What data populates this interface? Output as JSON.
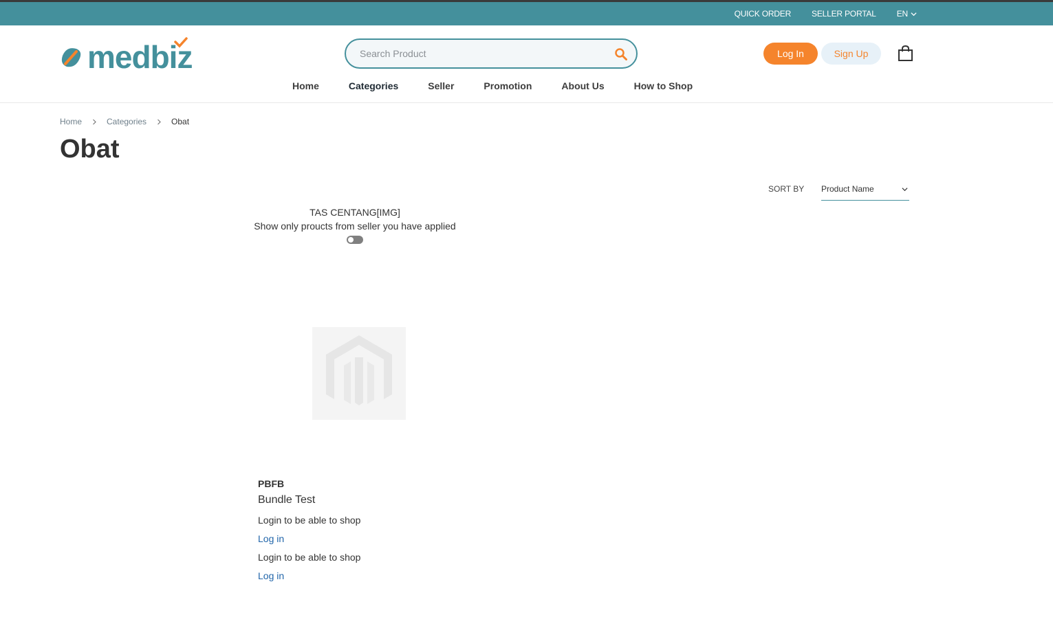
{
  "topbar": {
    "quick_order": "QUICK ORDER",
    "seller_portal": "SELLER PORTAL",
    "language": "EN"
  },
  "header": {
    "logo_text": "medbiz",
    "search_placeholder": "Search Product",
    "login_label": "Log In",
    "signup_label": "Sign Up",
    "cart_icon": "shopping-bag-icon"
  },
  "nav": {
    "items": [
      "Home",
      "Categories",
      "Seller",
      "Promotion",
      "About Us",
      "How to Shop"
    ],
    "active": "Categories"
  },
  "breadcrumb": {
    "items": [
      "Home",
      "Categories",
      "Obat"
    ]
  },
  "page": {
    "title": "Obat"
  },
  "sort": {
    "label": "SORT BY",
    "selected": "Product Name"
  },
  "filter": {
    "label": "TAS CENTANG[IMG]",
    "description": "Show only proucts from seller you have applied",
    "toggle_on": false
  },
  "product": {
    "seller": "PBFB",
    "name": "Bundle Test",
    "notes": [
      {
        "text": "Login to be able to shop",
        "link": "Log in"
      },
      {
        "text": "Login to be able to shop",
        "link": "Log in"
      }
    ]
  },
  "colors": {
    "primary_teal": "#44909c",
    "accent_orange": "#f5842c",
    "signup_bg": "#e7f1f8",
    "link_blue": "#2266aa"
  }
}
